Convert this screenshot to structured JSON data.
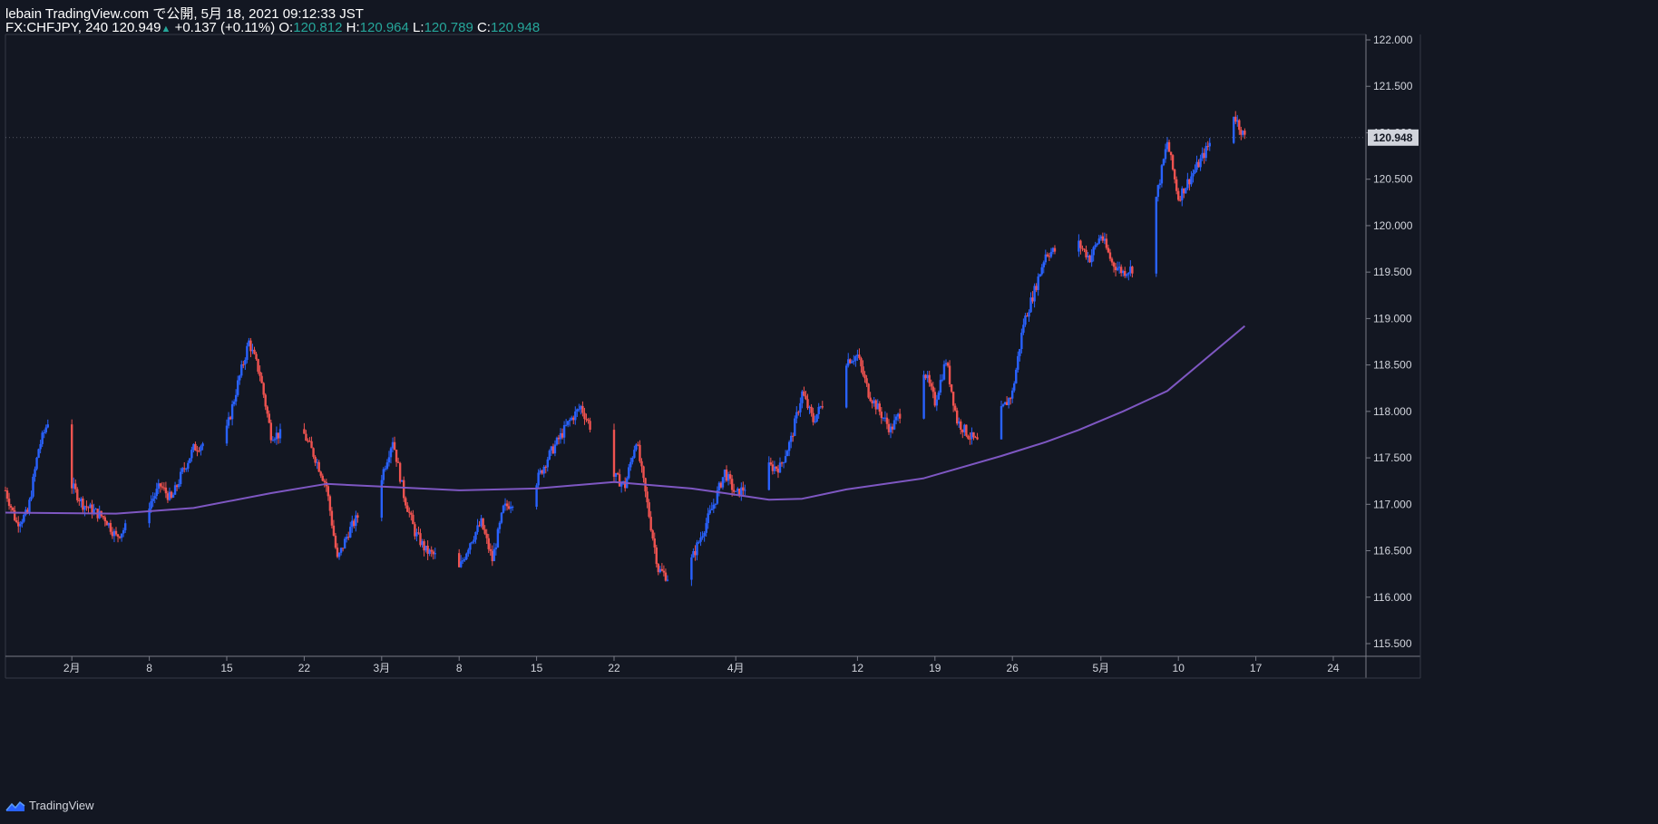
{
  "header": {
    "line1": "lebain TradingView.com で公開, 5月 18, 2021 09:12:33 JST",
    "symbol": "FX:CHFJPY, 240",
    "last": "120.949",
    "change_arrow": "▲",
    "change": "+0.137 (+0.11%)",
    "o_label": "O:",
    "o_value": "120.812",
    "h_label": "H:",
    "h_value": "120.964",
    "l_label": "L:",
    "l_value": "120.789",
    "c_label": "C:",
    "c_value": "120.948"
  },
  "footer": {
    "brand": "TradingView"
  },
  "colors": {
    "background": "#131722",
    "up": "#2962ff",
    "down": "#ef5350",
    "ma": "#7e57c2",
    "text": "#d1d4dc",
    "price_tag": "#d1d4dc"
  },
  "chart_data": {
    "type": "candlestick",
    "symbol": "FX:CHFJPY",
    "timeframe": "240",
    "y_ticks": [
      "122.000",
      "121.500",
      "121.000",
      "120.500",
      "120.000",
      "119.500",
      "119.000",
      "118.500",
      "118.000",
      "117.500",
      "117.000",
      "116.500",
      "116.000",
      "115.500"
    ],
    "ylim": [
      115.35,
      122.1
    ],
    "x_ticks": [
      "2月",
      "8",
      "15",
      "22",
      "3月",
      "8",
      "15",
      "22",
      "4月",
      "12",
      "19",
      "26",
      "5月",
      "10",
      "17",
      "24"
    ],
    "current_price": "120.948",
    "close_path": [
      {
        "d": "Jan 26",
        "p": 117.15
      },
      {
        "d": "Jan 27",
        "p": 116.8
      },
      {
        "d": "Jan 28",
        "p": 116.9
      },
      {
        "d": "Jan 29",
        "p": 117.6
      },
      {
        "d": "Jan 30",
        "p": 117.95
      },
      {
        "d": "Feb 1",
        "p": 117.2
      },
      {
        "d": "Feb 2",
        "p": 117.0
      },
      {
        "d": "Feb 4",
        "p": 116.85
      },
      {
        "d": "Feb 5",
        "p": 116.65
      },
      {
        "d": "Feb 8",
        "p": 117.0
      },
      {
        "d": "Feb 9",
        "p": 117.2
      },
      {
        "d": "Feb 10",
        "p": 117.05
      },
      {
        "d": "Feb 11",
        "p": 117.35
      },
      {
        "d": "Feb 12",
        "p": 117.6
      },
      {
        "d": "Feb 15",
        "p": 117.8
      },
      {
        "d": "Feb 16",
        "p": 118.3
      },
      {
        "d": "Feb 17",
        "p": 118.75
      },
      {
        "d": "Feb 18",
        "p": 118.4
      },
      {
        "d": "Feb 19",
        "p": 117.75
      },
      {
        "d": "Feb 22",
        "p": 117.75
      },
      {
        "d": "Feb 23",
        "p": 117.5
      },
      {
        "d": "Feb 24",
        "p": 117.2
      },
      {
        "d": "Feb 25",
        "p": 116.4
      },
      {
        "d": "Feb 26",
        "p": 116.7
      },
      {
        "d": "Mar 1",
        "p": 117.3
      },
      {
        "d": "Mar 2",
        "p": 117.7
      },
      {
        "d": "Mar 3",
        "p": 117.1
      },
      {
        "d": "Mar 4",
        "p": 116.7
      },
      {
        "d": "Mar 5",
        "p": 116.5
      },
      {
        "d": "Mar 8",
        "p": 116.3
      },
      {
        "d": "Mar 9",
        "p": 116.6
      },
      {
        "d": "Mar 10",
        "p": 116.8
      },
      {
        "d": "Mar 11",
        "p": 116.4
      },
      {
        "d": "Mar 12",
        "p": 116.95
      },
      {
        "d": "Mar 15",
        "p": 117.25
      },
      {
        "d": "Mar 16",
        "p": 117.5
      },
      {
        "d": "Mar 17",
        "p": 117.7
      },
      {
        "d": "Mar 18",
        "p": 117.9
      },
      {
        "d": "Mar 19",
        "p": 118.05
      },
      {
        "d": "Mar 22",
        "p": 117.3
      },
      {
        "d": "Mar 23",
        "p": 117.2
      },
      {
        "d": "Mar 24",
        "p": 117.7
      },
      {
        "d": "Mar 25",
        "p": 117.0
      },
      {
        "d": "Mar 26",
        "p": 116.3
      },
      {
        "d": "Mar 27",
        "p": 116.2
      },
      {
        "d": "Mar 29",
        "p": 116.4
      },
      {
        "d": "Mar 30",
        "p": 116.7
      },
      {
        "d": "Mar 31",
        "p": 117.0
      },
      {
        "d": "Apr 1",
        "p": 117.35
      },
      {
        "d": "Apr 2",
        "p": 117.1
      },
      {
        "d": "Apr 5",
        "p": 117.4
      },
      {
        "d": "Apr 6",
        "p": 117.4
      },
      {
        "d": "Apr 7",
        "p": 117.7
      },
      {
        "d": "Apr 8",
        "p": 118.2
      },
      {
        "d": "Apr 9",
        "p": 117.9
      },
      {
        "d": "Apr 12",
        "p": 118.55
      },
      {
        "d": "Apr 13",
        "p": 118.6
      },
      {
        "d": "Apr 14",
        "p": 118.2
      },
      {
        "d": "Apr 15",
        "p": 118.0
      },
      {
        "d": "Apr 16",
        "p": 117.8
      },
      {
        "d": "Apr 19",
        "p": 118.45
      },
      {
        "d": "Apr 20",
        "p": 118.1
      },
      {
        "d": "Apr 21",
        "p": 118.55
      },
      {
        "d": "Apr 22",
        "p": 117.9
      },
      {
        "d": "Apr 23",
        "p": 117.75
      },
      {
        "d": "Apr 24",
        "p": 117.65
      },
      {
        "d": "Apr 26",
        "p": 118.0
      },
      {
        "d": "Apr 27",
        "p": 118.2
      },
      {
        "d": "Apr 28",
        "p": 118.95
      },
      {
        "d": "Apr 29",
        "p": 119.3
      },
      {
        "d": "Apr 30",
        "p": 119.7
      },
      {
        "d": "May 3",
        "p": 119.8
      },
      {
        "d": "May 4",
        "p": 119.65
      },
      {
        "d": "May 5",
        "p": 119.9
      },
      {
        "d": "May 6",
        "p": 119.6
      },
      {
        "d": "May 7",
        "p": 119.5
      },
      {
        "d": "May 8",
        "p": 119.55
      },
      {
        "d": "May 10",
        "p": 120.3
      },
      {
        "d": "May 11",
        "p": 120.9
      },
      {
        "d": "May 12",
        "p": 120.3
      },
      {
        "d": "May 13",
        "p": 120.5
      },
      {
        "d": "May 14",
        "p": 120.7
      },
      {
        "d": "May 16",
        "p": 121.15
      },
      {
        "d": "May 17",
        "p": 121.2
      },
      {
        "d": "May 18",
        "p": 120.948
      }
    ],
    "ma_series": {
      "color": "#7e57c2",
      "points": [
        {
          "d": "Jan 26",
          "v": 116.91
        },
        {
          "d": "Feb 5",
          "v": 116.9
        },
        {
          "d": "Feb 12",
          "v": 116.96
        },
        {
          "d": "Feb 19",
          "v": 117.12
        },
        {
          "d": "Feb 24",
          "v": 117.22
        },
        {
          "d": "Mar 1",
          "v": 117.19
        },
        {
          "d": "Mar 8",
          "v": 117.15
        },
        {
          "d": "Mar 15",
          "v": 117.17
        },
        {
          "d": "Mar 22",
          "v": 117.24
        },
        {
          "d": "Mar 29",
          "v": 117.17
        },
        {
          "d": "Apr 1",
          "v": 117.12
        },
        {
          "d": "Apr 5",
          "v": 117.05
        },
        {
          "d": "Apr 8",
          "v": 117.06
        },
        {
          "d": "Apr 12",
          "v": 117.16
        },
        {
          "d": "Apr 19",
          "v": 117.28
        },
        {
          "d": "Apr 26",
          "v": 117.52
        },
        {
          "d": "Apr 30",
          "v": 117.67
        },
        {
          "d": "May 3",
          "v": 117.8
        },
        {
          "d": "May 7",
          "v": 118.0
        },
        {
          "d": "May 11",
          "v": 118.22
        },
        {
          "d": "May 14",
          "v": 118.52
        },
        {
          "d": "May 18",
          "v": 118.92
        }
      ]
    }
  }
}
